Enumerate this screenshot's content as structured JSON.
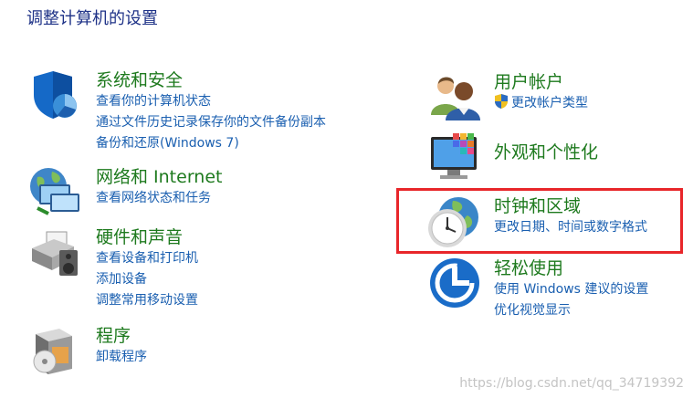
{
  "page": {
    "title": "调整计算机的设置"
  },
  "left_categories": [
    {
      "title": "系统和安全",
      "links": [
        "查看你的计算机状态",
        "通过文件历史记录保存你的文件备份副本",
        "备份和还原(Windows 7)"
      ]
    },
    {
      "title": "网络和 Internet",
      "links": [
        "查看网络状态和任务"
      ]
    },
    {
      "title": "硬件和声音",
      "links": [
        "查看设备和打印机",
        "添加设备",
        "调整常用移动设置"
      ]
    },
    {
      "title": "程序",
      "links": [
        "卸载程序"
      ]
    }
  ],
  "right_categories": [
    {
      "title": "用户帐户",
      "links": [
        "更改帐户类型"
      ]
    },
    {
      "title": "外观和个性化",
      "links": []
    },
    {
      "title": "时钟和区域",
      "links": [
        "更改日期、时间或数字格式"
      ]
    },
    {
      "title": "轻松使用",
      "links": [
        "使用 Windows 建议的设置",
        "优化视觉显示"
      ]
    }
  ],
  "watermark": "https://blog.csdn.net/qq_34719392",
  "colors": {
    "title": "#1e3287",
    "category": "#1e7a1e",
    "link": "#1a5fb0",
    "highlight": "#e8262a"
  }
}
